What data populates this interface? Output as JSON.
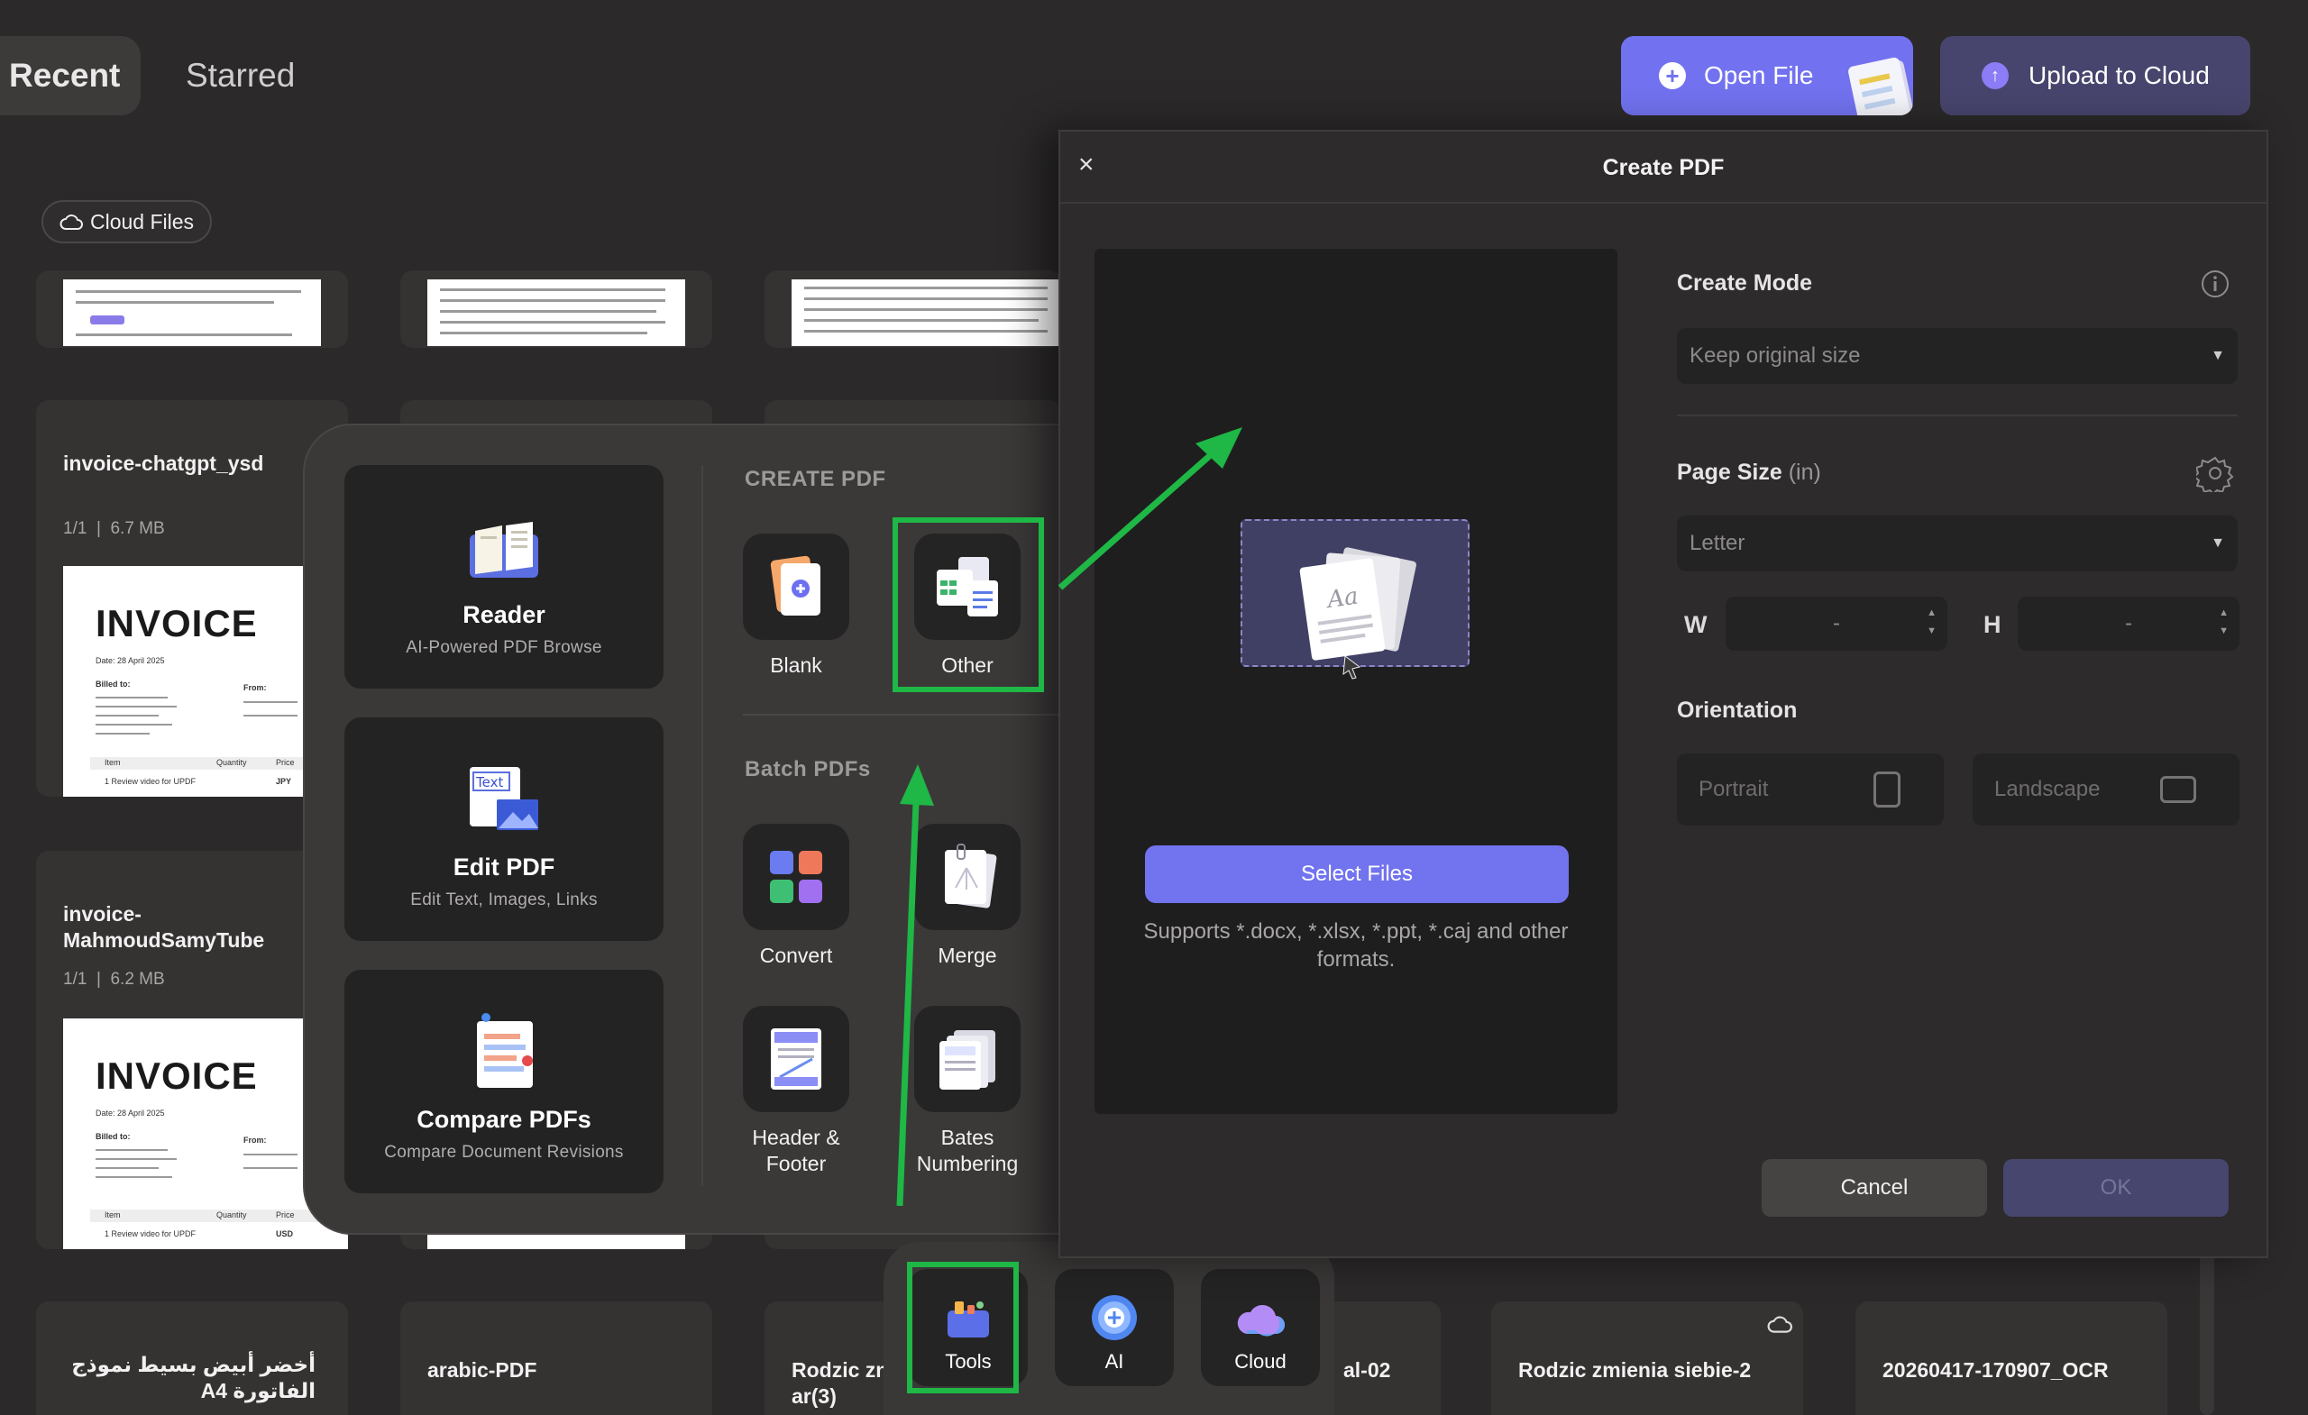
{
  "header": {
    "tabs": [
      {
        "label": "Recent"
      },
      {
        "label": "Starred"
      }
    ],
    "open_file_label": "Open File",
    "upload_label": "Upload to Cloud"
  },
  "cloud_files_label": "Cloud Files",
  "files": [
    {
      "title": "invoice-chatgpt_ysd",
      "pages": "1/1",
      "size": "6.7 MB"
    },
    {
      "title": "invoice-\nMahmoudSamyTube",
      "pages": "1/1",
      "size": "6.2 MB"
    },
    {
      "title": "أخضر أبيض بسيط نموذج الفاتورة A4"
    },
    {
      "title": "arabic-PDF"
    },
    {
      "title": "Rodzic zn ar(3)"
    },
    {
      "title": "al-02"
    },
    {
      "title": "Rodzic zmienia siebie-2"
    },
    {
      "title": "20260417-170907_OCR"
    }
  ],
  "invoice_thumb": {
    "heading": "INVOICE",
    "date_1": "Date: 28 April 2025",
    "date_2": "Date: 28 April 2025",
    "billed_to": "Billed to:",
    "from": "From:",
    "item_col": "Item",
    "qty_col": "Quantity",
    "price_col": "Price",
    "row_1": "1 Review video for UPDF",
    "currency_1": "JPY",
    "currency_2": "USD"
  },
  "tools_panel": {
    "big_tiles": [
      {
        "title": "Reader",
        "subtitle": "AI-Powered PDF Browse"
      },
      {
        "title": "Edit PDF",
        "subtitle": "Edit Text, Images, Links"
      },
      {
        "title": "Compare PDFs",
        "subtitle": "Compare Document Revisions"
      }
    ],
    "create_pdf_heading": "CREATE PDF",
    "batch_heading": "Batch PDFs",
    "create_tools": [
      {
        "label": "Blank"
      },
      {
        "label": "Other"
      }
    ],
    "batch_tools": [
      {
        "label": "Convert"
      },
      {
        "label": "Merge"
      },
      {
        "label": "Header &\nFooter"
      },
      {
        "label": "Bates\nNumbering"
      }
    ],
    "edit_icon_text": "Text"
  },
  "dialog": {
    "title": "Create PDF",
    "select_files_label": "Select Files",
    "supports_text": "Supports *.docx, *.xlsx, *.ppt, *.caj and other formats.",
    "create_mode_label": "Create Mode",
    "create_mode_value": "Keep original size",
    "page_size_label": "Page Size",
    "page_size_unit": "(in)",
    "page_size_value": "Letter",
    "width_label": "W",
    "height_label": "H",
    "width_value": "-",
    "height_value": "-",
    "orientation_label": "Orientation",
    "portrait_label": "Portrait",
    "landscape_label": "Landscape",
    "cancel_label": "Cancel",
    "ok_label": "OK",
    "drop_icon_text": "Aa"
  },
  "dock": [
    {
      "label": "Tools"
    },
    {
      "label": "AI"
    },
    {
      "label": "Cloud"
    }
  ],
  "colors": {
    "accent": "#7272f0",
    "highlight": "#1fb746",
    "background": "#2b2929"
  }
}
